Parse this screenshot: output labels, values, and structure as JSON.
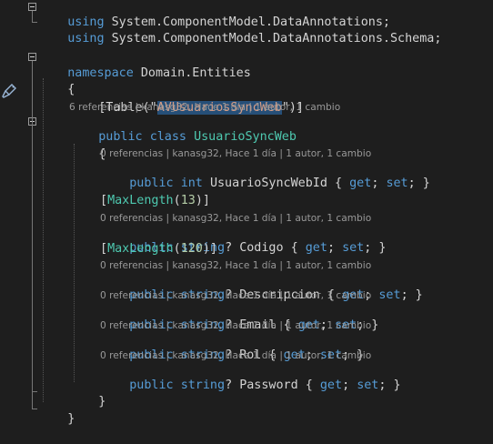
{
  "code": {
    "using_kw": "using",
    "using1_ns": "System.ComponentModel.DataAnnotations",
    "using2_ns": "System.ComponentModel.DataAnnotations.Schema",
    "semicolon": ";",
    "namespace_kw": "namespace",
    "namespace_name": "Domain.Entities",
    "open_brace": "{",
    "close_brace": "}",
    "table_attr_open": "[Table(\"",
    "table_attr_name": "AVUsuariosSyncWeb",
    "table_attr_close": "\")]",
    "class_lens": "6 referencias | kanasg32, Hace 1 día | 1 autor, 1 cambio",
    "public_kw": "public",
    "class_kw": "class",
    "class_name": "UsuarioSyncWeb",
    "prop_lens": "0 referencias | kanasg32, Hace 1 día | 1 autor, 1 cambio",
    "int_kw": "int",
    "string_kw": "string",
    "get_kw": "get",
    "set_kw": "set",
    "prop1_name": "UsuarioSyncWebId",
    "maxlength_attr": "MaxLength",
    "maxlength1": "13",
    "maxlength2": "120",
    "prop2_name": "Codigo",
    "prop3_name": "Descripcion",
    "prop4_name": "Email",
    "prop5_name": "Rol",
    "prop6_name": "Password"
  },
  "colors": {
    "background": "#1e1e1e",
    "keyword": "#569cd6",
    "type": "#4ec9b0",
    "string": "#d69d85",
    "number": "#b5cea8",
    "lens": "#999999",
    "selection": "#264f78"
  },
  "icons": {
    "margin": "brush-icon",
    "fold": "collapse-icon"
  }
}
